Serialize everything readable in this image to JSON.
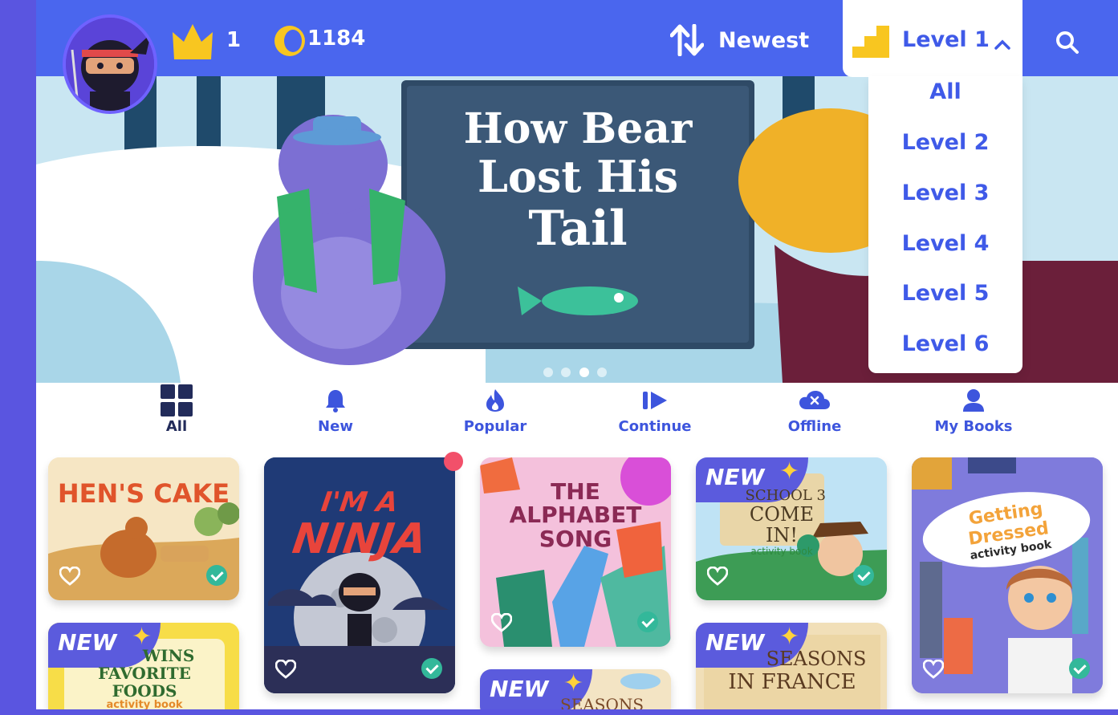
{
  "header": {
    "crowns": "1",
    "coins": "1184",
    "sort_label": "Newest",
    "level_label": "Level 1"
  },
  "hero": {
    "title_line1": "How Bear",
    "title_line2": "Lost His",
    "title_line3": "Tail",
    "carousel_count": 4,
    "carousel_active": 3
  },
  "level_dropdown": {
    "options": [
      "All",
      "Level 2",
      "Level 3",
      "Level 4",
      "Level 5",
      "Level 6"
    ]
  },
  "tabs": [
    {
      "label": "All",
      "icon": "grid-icon",
      "active": true
    },
    {
      "label": "New",
      "icon": "bell-icon"
    },
    {
      "label": "Popular",
      "icon": "flame-icon"
    },
    {
      "label": "Continue",
      "icon": "resume-icon"
    },
    {
      "label": "Offline",
      "icon": "cloud-icon"
    },
    {
      "label": "My Books",
      "icon": "person-icon"
    }
  ],
  "books": [
    {
      "title": "HEN'S CAKE",
      "new": false,
      "completed": true
    },
    {
      "title_line1": "I'M A",
      "title_line2": "NINJA",
      "new": false,
      "completed": true
    },
    {
      "title_line1": "THE",
      "title_line2": "ALPHABET",
      "title_line3": "SONG",
      "new": false,
      "completed": true
    },
    {
      "title_line1": "SCHOOL 3",
      "title_line2": "COME IN!",
      "subtitle": "activity book",
      "new": true,
      "completed": true
    },
    {
      "title": "Getting Dressed",
      "subtitle": "activity book",
      "new": false,
      "completed": true
    },
    {
      "title_line1": "WINS",
      "title_line2": "FAVORITE FOODS",
      "subtitle": "activity book",
      "new": true
    },
    {
      "title_line1": "SEASONS",
      "new": true
    },
    {
      "title_line1": "SEASONS",
      "title_line2": "IN FRANCE",
      "new": true
    }
  ],
  "labels": {
    "new_tag": "NEW"
  },
  "colors": {
    "primary": "#4a66ee",
    "accent_text": "#3f5ae8",
    "active_tab": "#222b5a",
    "check": "#33b89a",
    "coin": "#f8c620",
    "notification": "#f2506a"
  }
}
